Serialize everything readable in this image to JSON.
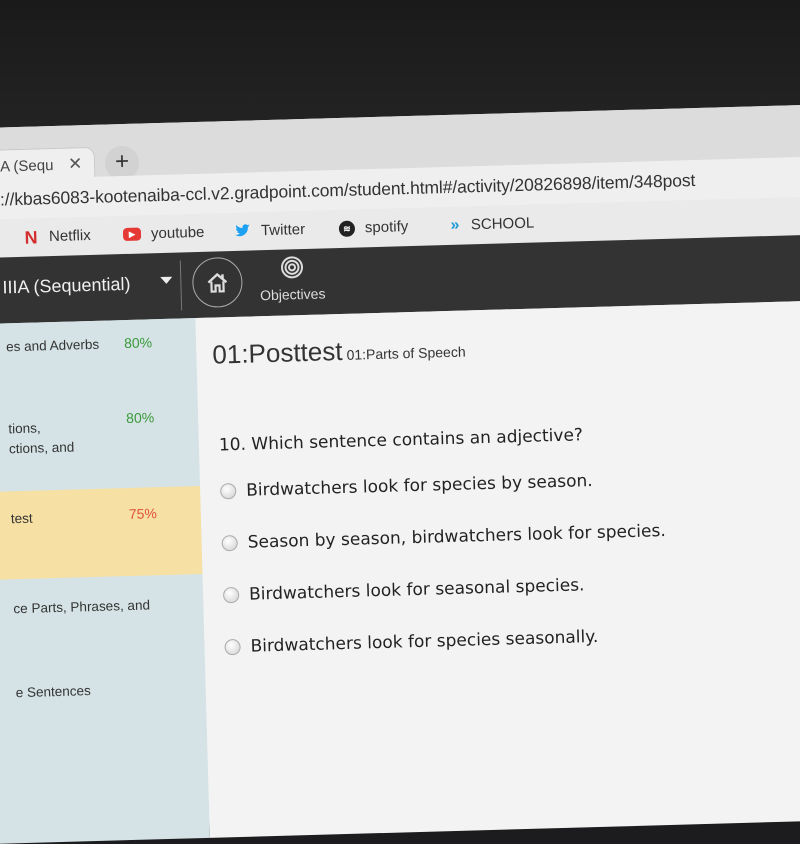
{
  "browser": {
    "tab_title": "A (Sequ",
    "tab_close": "✕",
    "new_tab": "+",
    "url": "://kbas6083-kootenaiba-ccl.v2.gradpoint.com/student.html#/activity/20826898/item/348post",
    "bookmarks": [
      {
        "label": "Netflix",
        "icon": "netflix-icon",
        "glyph": "N"
      },
      {
        "label": "youtube",
        "icon": "youtube-icon",
        "glyph": "▶"
      },
      {
        "label": "Twitter",
        "icon": "twitter-icon",
        "glyph": "🐦"
      },
      {
        "label": "spotify",
        "icon": "spotify-icon",
        "glyph": "≋"
      },
      {
        "label": "SCHOOL",
        "icon": "school-icon",
        "glyph": "»"
      }
    ]
  },
  "appbar": {
    "course_title": "IIIA (Sequential)",
    "home_icon": "home-icon",
    "objectives_label": "Objectives"
  },
  "sidebar": {
    "items": [
      {
        "label": "es and Adverbs",
        "percent": "80%",
        "color": "#3c9a3c"
      },
      {
        "label": "tions,\nctions, and",
        "percent": "80%",
        "color": "#3c9a3c"
      },
      {
        "label": "test",
        "percent": "75%",
        "color": "#e0533a",
        "active": true
      },
      {
        "label": "ce Parts, Phrases, and",
        "percent": ""
      },
      {
        "label": "e Sentences",
        "percent": ""
      }
    ]
  },
  "main": {
    "title": "01:Posttest",
    "subtitle": "01:Parts of Speech",
    "question": "10. Which sentence contains an adjective?",
    "options": [
      "Birdwatchers look for species by season.",
      "Season by season, birdwatchers look for species.",
      "Birdwatchers look for seasonal species.",
      "Birdwatchers look for species seasonally."
    ]
  }
}
